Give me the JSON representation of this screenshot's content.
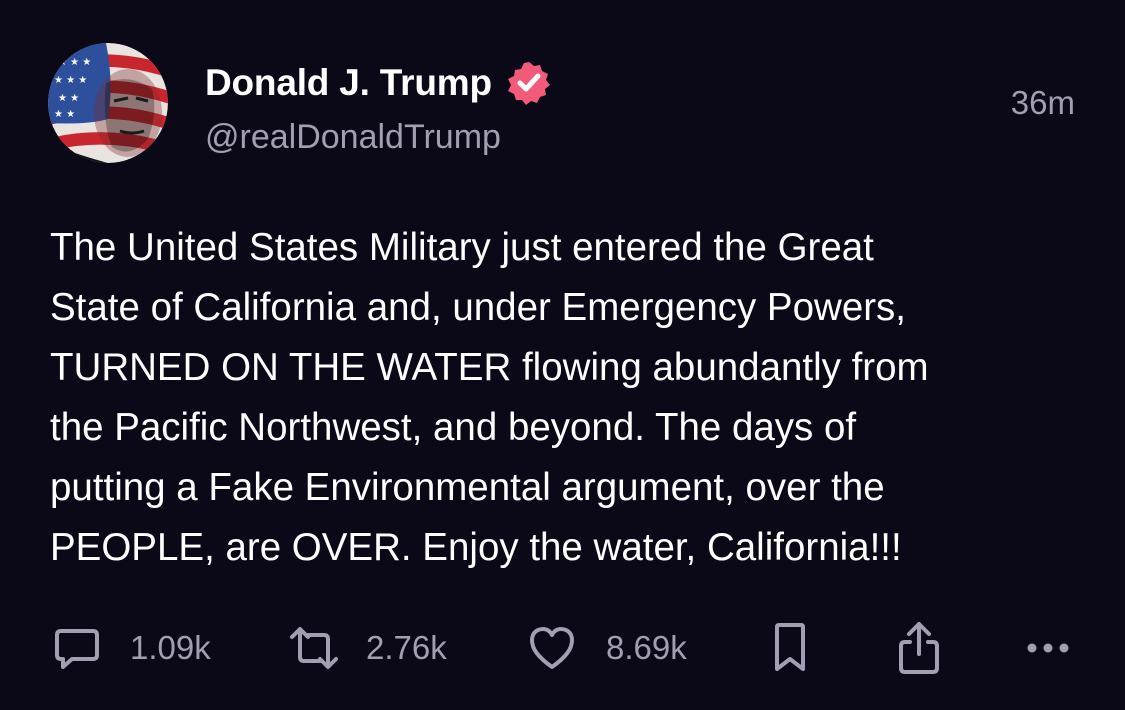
{
  "post": {
    "author": {
      "display_name": "Donald J. Trump",
      "handle": "@realDonaldTrump",
      "verified": true,
      "avatar_icon": "flag-portrait-avatar"
    },
    "timestamp": "36m",
    "text": "The United States Military just entered the Great\nState of California and, under Emergency Powers,\nTURNED ON THE WATER flowing abundantly from\nthe Pacific Northwest, and beyond. The days of\nputting a Fake Environmental argument, over the\nPEOPLE, are OVER. Enjoy the water, California!!!",
    "actions": {
      "replies": {
        "icon": "comment-icon",
        "count": "1.09k"
      },
      "reposts": {
        "icon": "repost-icon",
        "count": "2.76k"
      },
      "likes": {
        "icon": "heart-icon",
        "count": "8.69k"
      },
      "bookmark": {
        "icon": "bookmark-icon"
      },
      "share": {
        "icon": "share-icon"
      },
      "more": {
        "icon": "more-icon"
      }
    }
  },
  "colors": {
    "background": "#0b0817",
    "text_primary": "#ffffff",
    "text_secondary": "#a29fb3",
    "verified_badge": "#f25a7a"
  }
}
